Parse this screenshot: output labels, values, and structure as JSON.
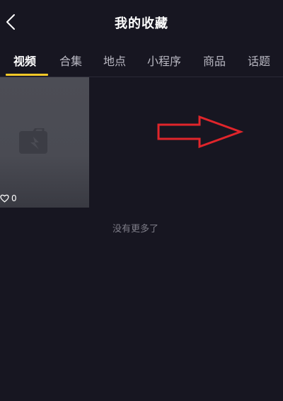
{
  "header": {
    "title": "我的收藏"
  },
  "tabs": [
    {
      "label": "视频",
      "active": true
    },
    {
      "label": "合集",
      "active": false
    },
    {
      "label": "地点",
      "active": false
    },
    {
      "label": "小程序",
      "active": false
    },
    {
      "label": "商品",
      "active": false
    },
    {
      "label": "话题",
      "active": false
    }
  ],
  "video": {
    "likes": "0"
  },
  "footer": {
    "no_more_text": "没有更多了"
  },
  "colors": {
    "background": "#171621",
    "tab_indicator": "#f5c928",
    "annotation_arrow": "#e0252b"
  }
}
